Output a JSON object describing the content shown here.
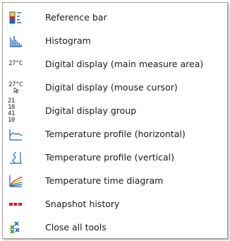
{
  "menu": {
    "items": [
      {
        "label": "Reference bar",
        "icon": "reference-bar-icon"
      },
      {
        "label": "Histogram",
        "icon": "histogram-icon"
      },
      {
        "label": "Digital display (main measure area)",
        "icon": "digital-display-icon",
        "icon_text": "27°C"
      },
      {
        "label": "Digital display (mouse cursor)",
        "icon": "digital-display-cursor-icon",
        "icon_text": "27°C"
      },
      {
        "label": "Digital display group",
        "icon": "digital-display-group-icon",
        "icon_text": [
          "21 18",
          "41 10"
        ]
      },
      {
        "label": "Temperature profile (horizontal)",
        "icon": "temperature-profile-horizontal-icon"
      },
      {
        "label": "Temperature profile (vertical)",
        "icon": "temperature-profile-vertical-icon"
      },
      {
        "label": "Temperature time diagram",
        "icon": "temperature-time-diagram-icon"
      },
      {
        "label": "Snapshot history",
        "icon": "snapshot-history-icon"
      },
      {
        "label": "Close all tools",
        "icon": "close-all-tools-icon"
      }
    ]
  },
  "colors": {
    "accent_blue": "#1f5fbf",
    "reference_red": "#e02020",
    "reference_yellow": "#f2d21a",
    "snapshot_red": "#d21f1f",
    "close_green": "#2a9a3a",
    "close_blue": "#2a5fc8"
  }
}
